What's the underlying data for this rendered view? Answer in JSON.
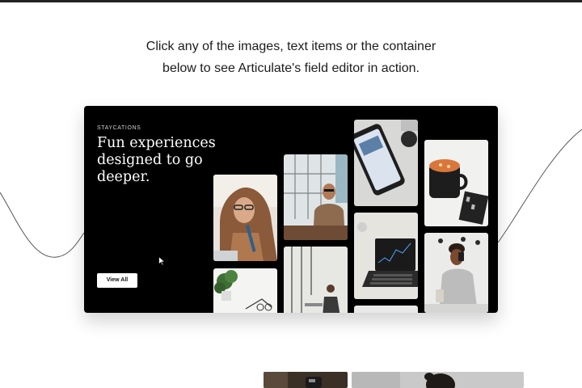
{
  "intro": {
    "line1": "Click any of the images, text items or the container",
    "line2": "below to see Articulate's field editor in action."
  },
  "card": {
    "eyebrow": "STAYCATIONS",
    "headline": "Fun experiences designed to go deeper.",
    "button_label": "View All"
  },
  "gallery": [
    {
      "name": "photo-woman-with-glasses"
    },
    {
      "name": "photo-plant-desk"
    },
    {
      "name": "photo-man-by-window"
    },
    {
      "name": "photo-person-in-room"
    },
    {
      "name": "photo-phone-on-table"
    },
    {
      "name": "photo-laptop-chart"
    },
    {
      "name": "photo-partial-bottom"
    },
    {
      "name": "photo-soup-bowl"
    },
    {
      "name": "photo-woman-with-phone"
    }
  ],
  "colors": {
    "card_background": "#000000",
    "page_background": "#ffffff",
    "text": "#1c1c1c"
  },
  "icons": {
    "cursor": "mouse-pointer-icon"
  }
}
